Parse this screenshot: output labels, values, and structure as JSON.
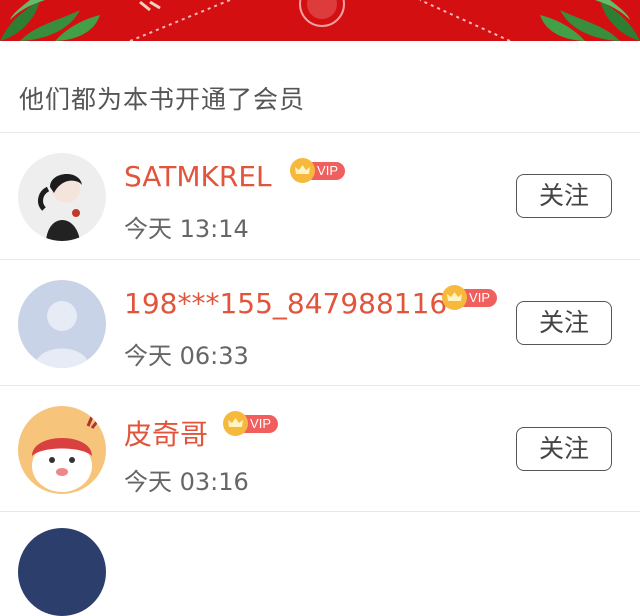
{
  "section": {
    "title": "他们都为本书开通了会员"
  },
  "colors": {
    "banner": "#d40f12",
    "name": "#e1553c",
    "vip_pill": "#f05e5e",
    "vip_crown": "#f6b93b"
  },
  "members": [
    {
      "name": "SATMKREL",
      "badge": "VIP",
      "time": "今天 13:14",
      "follow_label": "关注",
      "avatar": "girl-illustration"
    },
    {
      "name": "198***155_847988116",
      "badge": "VIP",
      "time": "今天 06:33",
      "follow_label": "关注",
      "avatar": "default-user"
    },
    {
      "name": "皮奇哥",
      "badge": "VIP",
      "time": "今天 03:16",
      "follow_label": "关注",
      "avatar": "cartoon-character"
    }
  ]
}
